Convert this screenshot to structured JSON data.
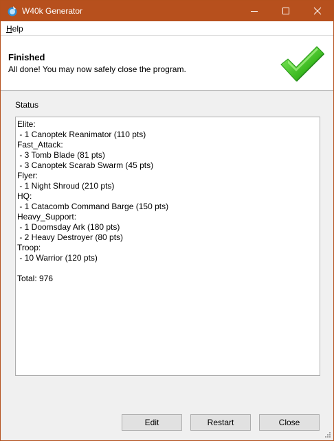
{
  "window": {
    "title": "W40k Generator",
    "app_icon": "app-icon",
    "accent": "#b7501d"
  },
  "menu": {
    "help_access": "H",
    "help_rest": "elp"
  },
  "header": {
    "title": "Finished",
    "subtitle": "All done! You may now safely close the program.",
    "icon": "green-checkmark-icon"
  },
  "status": {
    "label": "Status",
    "lines": [
      "Elite:",
      " - 1 Canoptek Reanimator (110 pts)",
      "Fast_Attack:",
      " - 3 Tomb Blade (81 pts)",
      " - 3 Canoptek Scarab Swarm (45 pts)",
      "Flyer:",
      " - 1 Night Shroud (210 pts)",
      "HQ:",
      " - 1 Catacomb Command Barge (150 pts)",
      "Heavy_Support:",
      " - 1 Doomsday Ark (180 pts)",
      " - 2 Heavy Destroyer (80 pts)",
      "Troop:",
      " - 10 Warrior (120 pts)",
      "",
      "Total: 976"
    ]
  },
  "buttons": {
    "edit": "Edit",
    "restart": "Restart",
    "close": "Close"
  }
}
